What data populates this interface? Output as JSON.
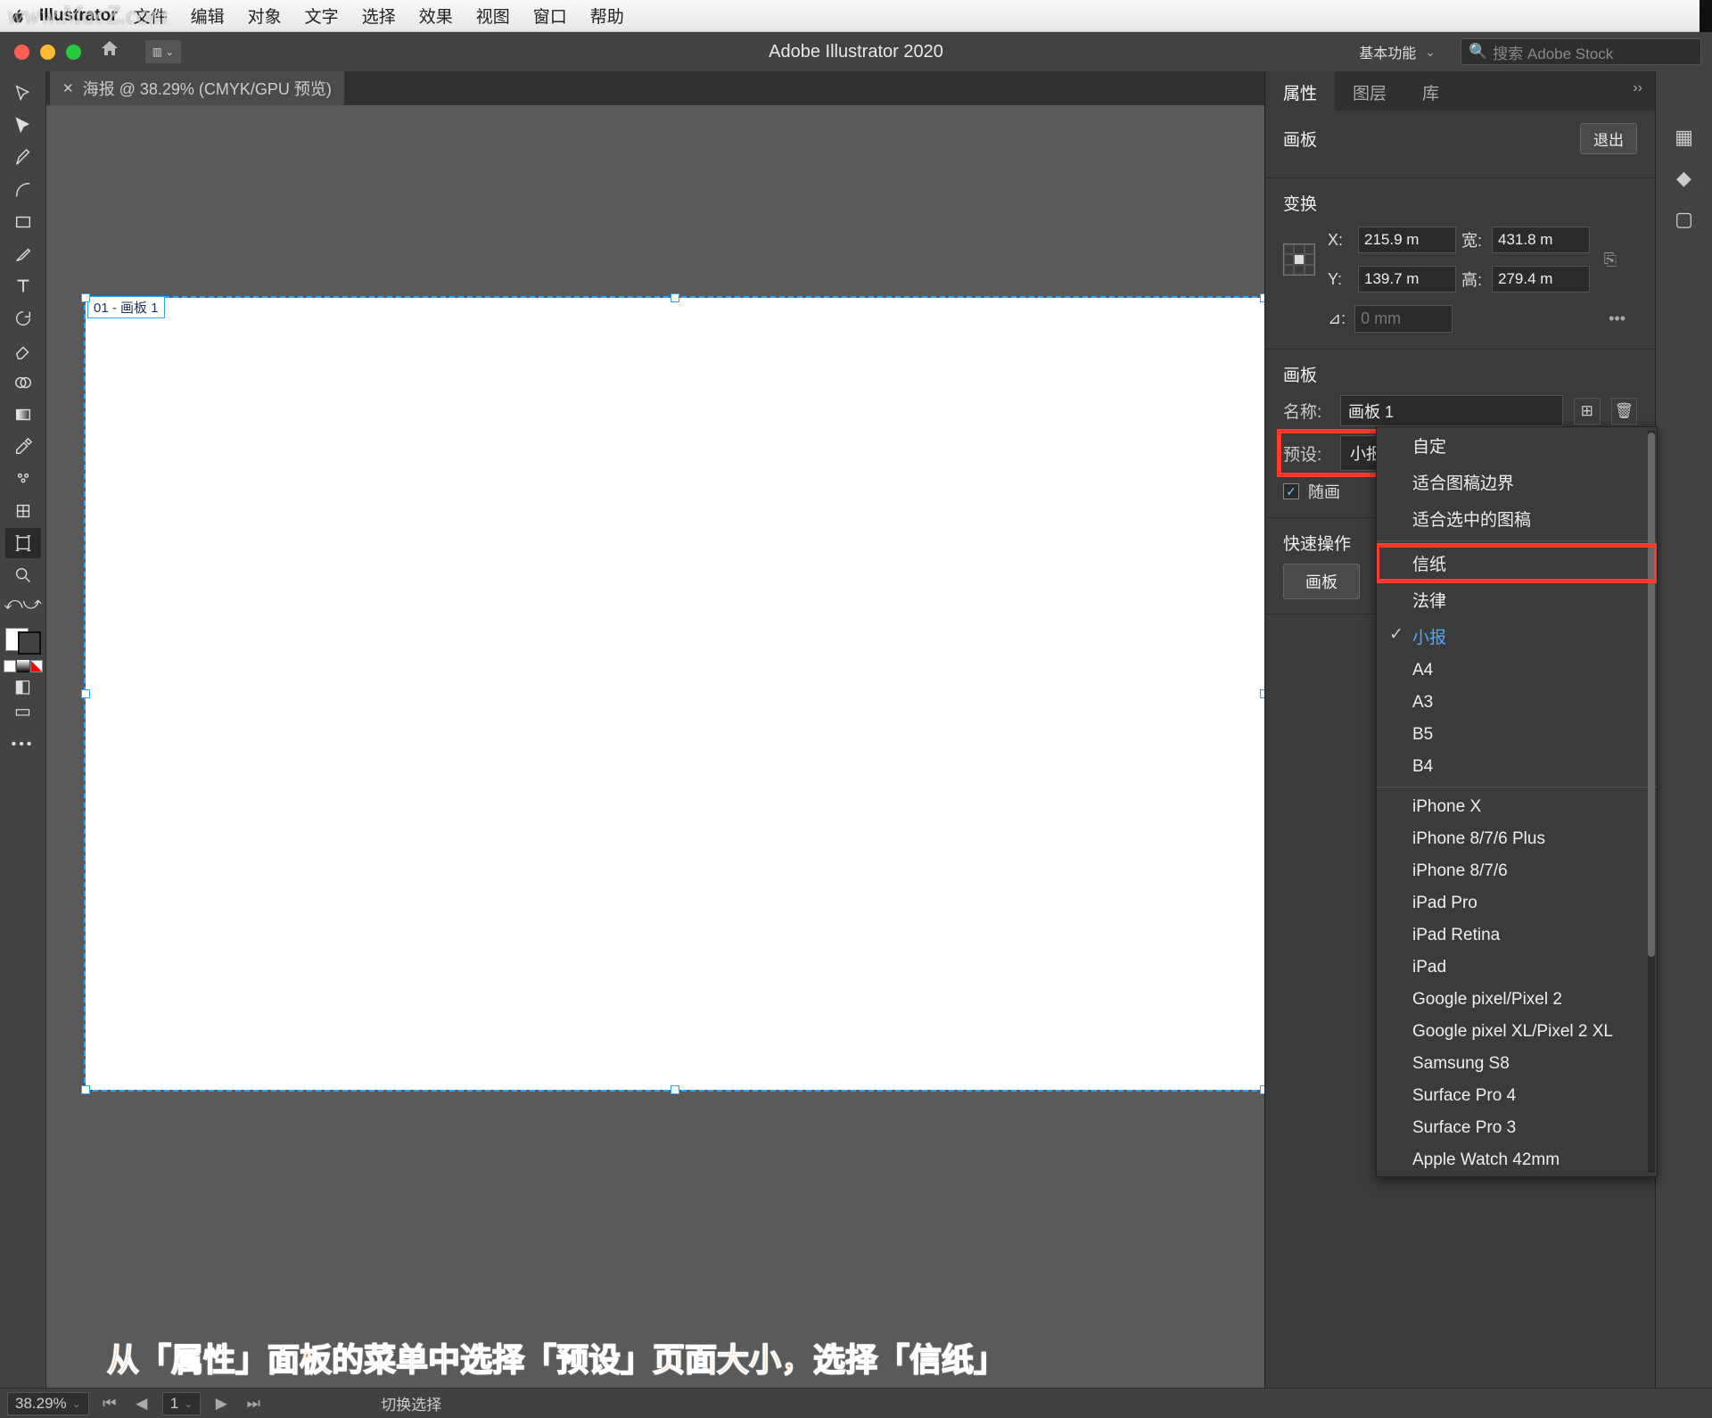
{
  "watermark": "www.MacZ.com",
  "mac_menu": {
    "app": "Illustrator",
    "items": [
      "文件",
      "编辑",
      "对象",
      "文字",
      "选择",
      "效果",
      "视图",
      "窗口",
      "帮助"
    ]
  },
  "titlebar": {
    "app_title": "Adobe Illustrator 2020",
    "workspace": "基本功能",
    "search_placeholder": "搜索 Adobe Stock"
  },
  "doc_tab": {
    "title": "海报 @ 38.29% (CMYK/GPU 预览)"
  },
  "artboard": {
    "label": "01 - 画板 1"
  },
  "panel": {
    "tabs": {
      "properties": "属性",
      "layers": "图层",
      "libraries": "库"
    },
    "section_artboard_title": "画板",
    "exit_label": "退出",
    "section_transform_title": "变换",
    "transform": {
      "x_label": "X:",
      "y_label": "Y:",
      "w_label": "宽:",
      "h_label": "高:",
      "x": "215.9 m",
      "y": "139.7 m",
      "w": "431.8 m",
      "h": "279.4 m",
      "angle_label": "⊿:",
      "angle": "0 mm"
    },
    "artboard_section": {
      "title": "画板",
      "name_label": "名称:",
      "name_value": "画板 1",
      "preset_label": "预设:",
      "preset_value": "小报",
      "move_art_label": "随画"
    },
    "quick_ops": {
      "title": "快速操作",
      "btn": "画板"
    },
    "dropdown": {
      "items": [
        {
          "label": "自定"
        },
        {
          "label": "适合图稿边界"
        },
        {
          "label": "适合选中的图稿"
        },
        {
          "sep": true
        },
        {
          "label": "信纸",
          "highlight": true
        },
        {
          "label": "法律"
        },
        {
          "label": "小报",
          "checked": true,
          "selected": true
        },
        {
          "label": "A4"
        },
        {
          "label": "A3"
        },
        {
          "label": "B5"
        },
        {
          "label": "B4"
        },
        {
          "sep": true
        },
        {
          "label": "iPhone X"
        },
        {
          "label": "iPhone 8/7/6 Plus"
        },
        {
          "label": "iPhone 8/7/6"
        },
        {
          "label": "iPad Pro"
        },
        {
          "label": "iPad Retina"
        },
        {
          "label": "iPad"
        },
        {
          "label": "Google pixel/Pixel 2"
        },
        {
          "label": "Google pixel XL/Pixel 2 XL"
        },
        {
          "label": "Samsung S8"
        },
        {
          "label": "Surface Pro 4"
        },
        {
          "label": "Surface Pro 3"
        },
        {
          "label": "Apple Watch 42mm"
        }
      ]
    }
  },
  "statusbar": {
    "zoom": "38.29%",
    "artboard_index": "1",
    "tool_hint": "切换选择"
  },
  "caption": "从「属性」面板的菜单中选择「预设」页面大小，选择「信纸」"
}
